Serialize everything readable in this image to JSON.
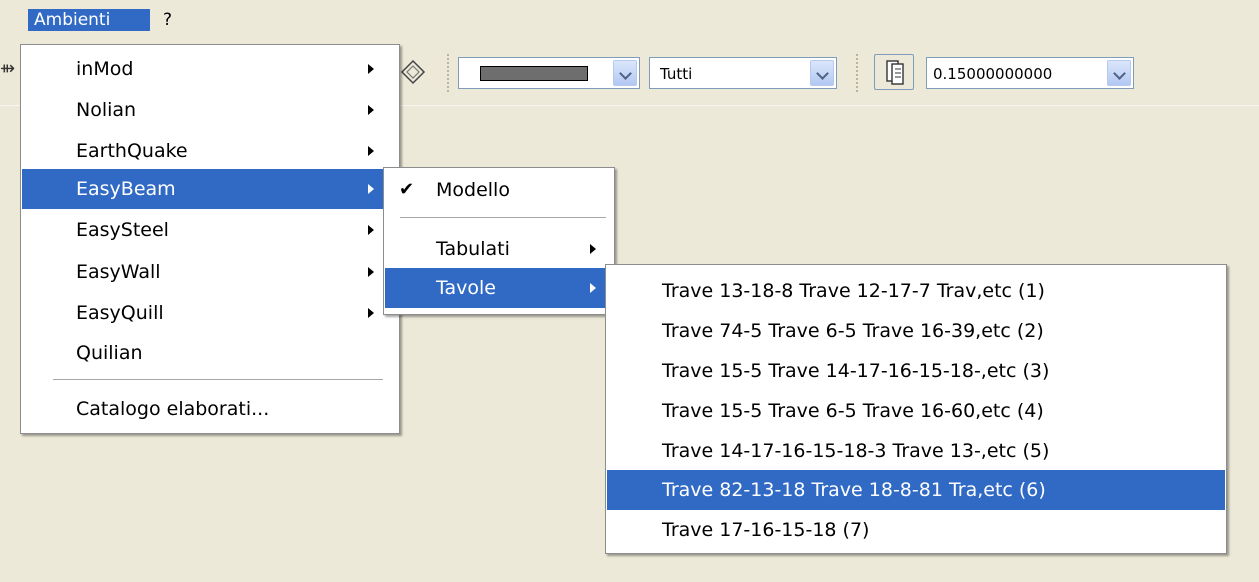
{
  "menubar": {
    "items": [
      {
        "label": "Ambienti",
        "active": true
      },
      {
        "label": "?",
        "active": false
      }
    ]
  },
  "toolbar": {
    "line_color": "#6e6e6e",
    "filter_value": "Tutti",
    "thickness_value": "0.15000000000",
    "icons": [
      "layers-icon",
      "pages-icon"
    ]
  },
  "menu_ambienti": {
    "items": [
      {
        "label": "inMod",
        "submenu": true
      },
      {
        "label": "Nolian",
        "submenu": true
      },
      {
        "label": "EarthQuake",
        "submenu": true
      },
      {
        "label": "EasyBeam",
        "submenu": true,
        "selected": true
      },
      {
        "label": "EasySteel",
        "submenu": true
      },
      {
        "label": "EasyWall",
        "submenu": true
      },
      {
        "label": "EasyQuill",
        "submenu": true
      },
      {
        "label": "Quilian",
        "submenu": false
      }
    ],
    "footer_item": "Catalogo elaborati..."
  },
  "menu_easybeam": {
    "items": [
      {
        "label": "Modello",
        "checked": true
      },
      {
        "label": "Tabulati",
        "submenu": true
      },
      {
        "label": "Tavole",
        "submenu": true,
        "selected": true
      }
    ]
  },
  "menu_tavole": {
    "items": [
      {
        "label": "Trave 13-18-8 Trave 12-17-7 Trav,etc (1)"
      },
      {
        "label": "Trave 74-5 Trave 6-5 Trave 16-39,etc (2)"
      },
      {
        "label": "Trave 15-5 Trave 14-17-16-15-18-,etc (3)"
      },
      {
        "label": "Trave 15-5 Trave 6-5 Trave 16-60,etc (4)"
      },
      {
        "label": "Trave 14-17-16-15-18-3 Trave 13-,etc (5)"
      },
      {
        "label": "Trave 82-13-18 Trave 18-8-81 Tra,etc (6)",
        "selected": true
      },
      {
        "label": "Trave 17-16-15-18 (7)"
      }
    ]
  },
  "colors": {
    "highlight": "#316ac5",
    "chrome": "#ece9d8"
  }
}
